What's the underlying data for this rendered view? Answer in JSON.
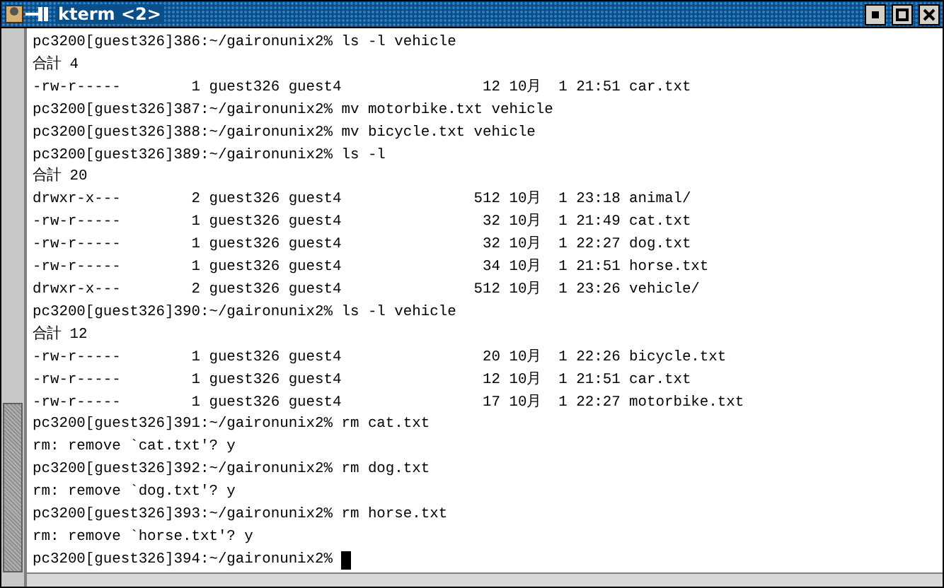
{
  "window": {
    "title": "kterm <2>"
  },
  "terminal": {
    "cursor": true,
    "lines": [
      "pc3200[guest326]386:~/gaironunix2% ls -l vehicle",
      "合計 4",
      "-rw-r-----        1 guest326 guest4                12 10月  1 21:51 car.txt",
      "pc3200[guest326]387:~/gaironunix2% mv motorbike.txt vehicle",
      "pc3200[guest326]388:~/gaironunix2% mv bicycle.txt vehicle",
      "pc3200[guest326]389:~/gaironunix2% ls -l",
      "合計 20",
      "drwxr-x---        2 guest326 guest4               512 10月  1 23:18 animal/",
      "-rw-r-----        1 guest326 guest4                32 10月  1 21:49 cat.txt",
      "-rw-r-----        1 guest326 guest4                32 10月  1 22:27 dog.txt",
      "-rw-r-----        1 guest326 guest4                34 10月  1 21:51 horse.txt",
      "drwxr-x---        2 guest326 guest4               512 10月  1 23:26 vehicle/",
      "pc3200[guest326]390:~/gaironunix2% ls -l vehicle",
      "合計 12",
      "-rw-r-----        1 guest326 guest4                20 10月  1 22:26 bicycle.txt",
      "-rw-r-----        1 guest326 guest4                12 10月  1 21:51 car.txt",
      "-rw-r-----        1 guest326 guest4                17 10月  1 22:27 motorbike.txt",
      "pc3200[guest326]391:~/gaironunix2% rm cat.txt",
      "rm: remove `cat.txt'? y",
      "pc3200[guest326]392:~/gaironunix2% rm dog.txt",
      "rm: remove `dog.txt'? y",
      "pc3200[guest326]393:~/gaironunix2% rm horse.txt",
      "rm: remove `horse.txt'? y",
      "pc3200[guest326]394:~/gaironunix2% "
    ]
  }
}
